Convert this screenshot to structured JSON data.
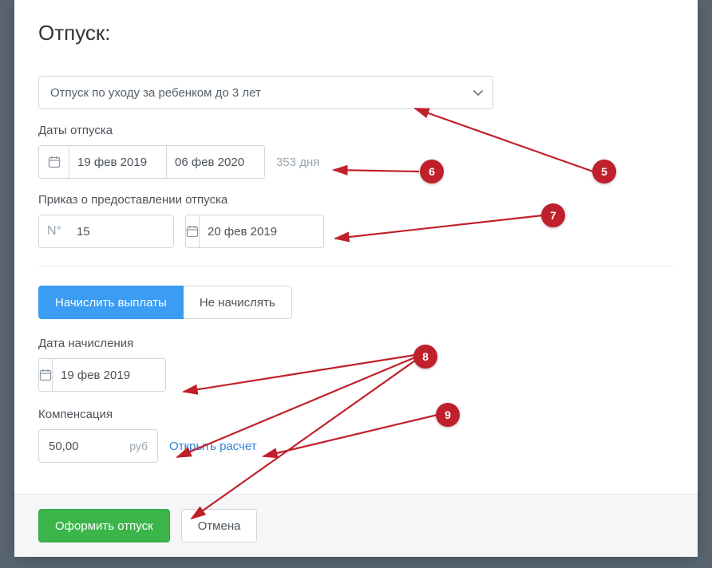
{
  "modal": {
    "title": "Отпуск:"
  },
  "vacation_type": {
    "selected": "Отпуск по уходу за ребенком до 3 лет"
  },
  "dates": {
    "section_label": "Даты отпуска",
    "start": "19 фев 2019",
    "end": "06 фев 2020",
    "duration": "353 дня"
  },
  "order": {
    "section_label": "Приказ о предоставлении отпуска",
    "number_prefix": "N°",
    "number": "15",
    "date": "20 фев 2019"
  },
  "payments": {
    "toggle_accrue": "Начислить выплаты",
    "toggle_skip": "Не начислять",
    "accrual_date_label": "Дата начисления",
    "accrual_date": "19 фев 2019",
    "compensation_label": "Компенсация",
    "compensation_value": "50,00",
    "compensation_currency": "руб",
    "open_calculation_link": "Открыть расчет"
  },
  "actions": {
    "submit": "Оформить отпуск",
    "cancel": "Отмена"
  },
  "annotations": {
    "b5": "5",
    "b6": "6",
    "b7": "7",
    "b8": "8",
    "b9": "9"
  }
}
